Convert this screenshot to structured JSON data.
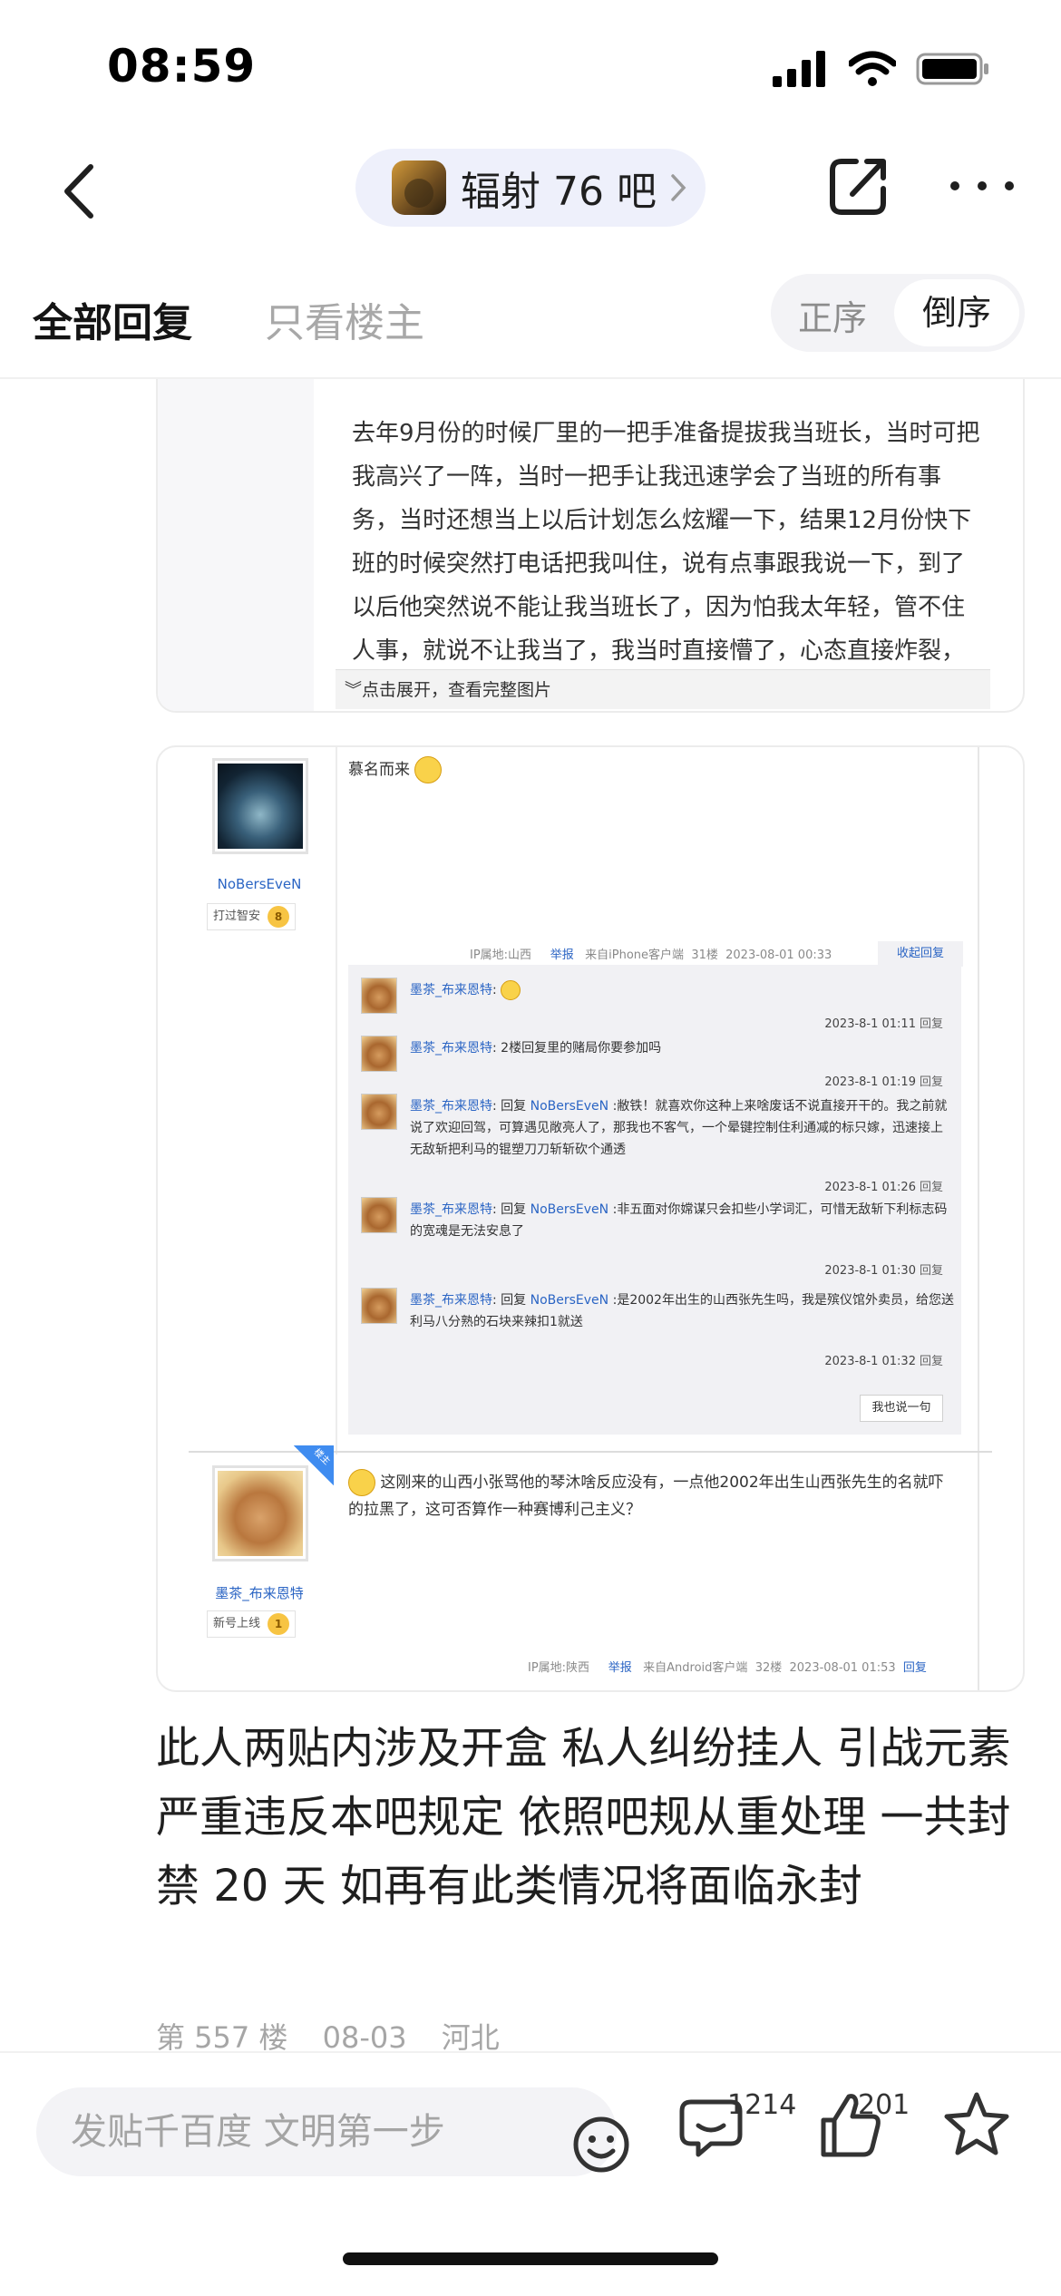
{
  "status": {
    "time": "08:59"
  },
  "nav": {
    "forum_name": "辐射 76 吧"
  },
  "tabs": {
    "all": "全部回复",
    "op_only": "只看楼主",
    "sort_asc": "正序",
    "sort_desc": "倒序"
  },
  "image1": {
    "text": "去年9月份的时候厂里的一把手准备提拔我当班长，当时可把我高兴了一阵，当时一把手让我迅速学会了当班的所有事务，当时还想当上以后计划怎么炫耀一下，结果12月份快下班的时候突然打电话把我叫住，说有点事跟我说一下，到了以后他突然说不能让我当班长了，因为怕我太年轻，管不住人事，就说不让我当了，我当时直接懵了，心态直接炸裂，回家都有种想",
    "expand": "︾点击展开，查看完整图片"
  },
  "image2": {
    "user1": {
      "name": "NoBersEveN",
      "level_title": "打过智安",
      "level": "8"
    },
    "post1": {
      "text": "慕名而来"
    },
    "meta1": {
      "ip": "IP属地:山西",
      "report": "举报",
      "client": "来自iPhone客户端",
      "floor": "31楼",
      "time": "2023-08-01 00:33",
      "collapse": "收起回复"
    },
    "replies": [
      {
        "user": "墨茶_布来恩特",
        "text": ":",
        "time": "2023-8-1 01:11",
        "action": "回复"
      },
      {
        "user": "墨茶_布来恩特",
        "text": ": 2楼回复里的赌局你要参加吗",
        "time": "2023-8-1 01:19",
        "action": "回复"
      },
      {
        "user": "墨茶_布来恩特",
        "pre": ": 回复 ",
        "target": "NoBersEveN",
        "text": " :敝铁！就喜欢你这种上来啥废话不说直接开干的。我之前就说了欢迎回驾，可算遇见敞亮人了，那我也不客气，一个晕键控制住利通减的标只嫁，迅速接上无敌斩把利马的锟塑刀刀斩斩砍个通透",
        "time": "2023-8-1 01:26",
        "action": "回复"
      },
      {
        "user": "墨茶_布来恩特",
        "pre": ": 回复 ",
        "target": "NoBersEveN",
        "text": " :非五面对你嫦谋只会扣些小学词汇，可惜无敌斩下利标志码的宽魂是无法安息了",
        "time": "2023-8-1 01:30",
        "action": "回复"
      },
      {
        "user": "墨茶_布来恩特",
        "pre": ": 回复 ",
        "target": "NoBersEveN",
        "text": " :是2002年出生的山西张先生吗，我是殡仪馆外卖员，给您送利马八分熟的石块来辣扣1就送",
        "time": "2023-8-1 01:32",
        "action": "回复"
      }
    ],
    "say_btn": "我也说一句",
    "op_badge": "楼主",
    "user2": {
      "name": "墨茶_布来恩特",
      "level_title": "新号上线",
      "level": "1"
    },
    "post2": {
      "text": "这刚来的山西小张骂他的琴沐啥反应没有，一点他2002年出生山西张先生的名就吓的拉黑了，这可否算作一种赛博利己主义？"
    },
    "meta2": {
      "ip": "IP属地:陕西",
      "report": "举报",
      "client": "来自Android客户端",
      "floor": "32楼",
      "time": "2023-08-01 01:53",
      "reply": "回复"
    }
  },
  "post": {
    "text": "此人两贴内涉及开盒 私人纠纷挂人 引战元素 严重违反本吧规定 依照吧规从重处理 一共封禁 20 天 如再有此类情况将面临永封",
    "floor": "第 557 楼",
    "date": "08-03",
    "location": "河北"
  },
  "bottom": {
    "compose_placeholder": "发贴千百度 文明第一步",
    "comment_count": "1214",
    "like_count": "201"
  }
}
